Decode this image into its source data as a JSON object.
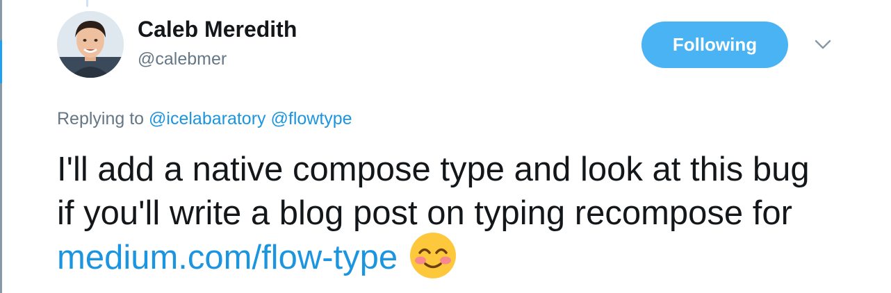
{
  "tweet": {
    "author": {
      "name": "Caleb Meredith",
      "handle": "@calebmer"
    },
    "follow_button_label": "Following",
    "reply": {
      "prefix": "Replying to",
      "mentions": [
        "@icelabaratory",
        "@flowtype"
      ]
    },
    "text": {
      "body": "I'll add a native compose type and look at this bug if you'll write a blog post on typing recompose for",
      "link": "medium.com/flow-type",
      "emoji": "smiling-face-with-smiling-eyes"
    }
  },
  "colors": {
    "accent": "#1b95e0",
    "button": "#4ab3f4",
    "text": "#14171a",
    "muted": "#657786"
  },
  "icons": {
    "menu": "chevron-down-icon"
  }
}
